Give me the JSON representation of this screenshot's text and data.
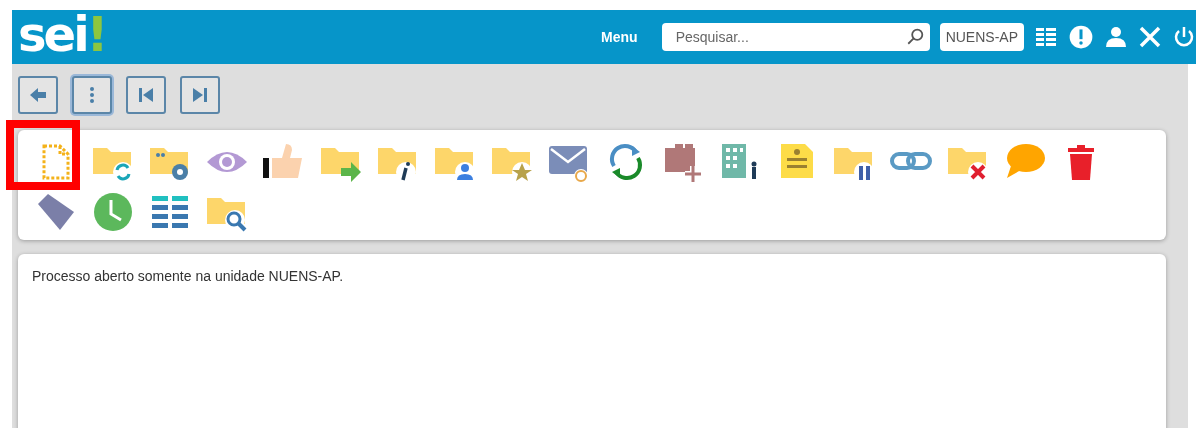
{
  "header": {
    "logo": "sei",
    "logo_mark": "!",
    "menu": "Menu",
    "search": {
      "placeholder": "Pesquisar..."
    },
    "unit": "NUENS-AP"
  },
  "message": "Processo aberto somente na unidade NUENS-AP."
}
